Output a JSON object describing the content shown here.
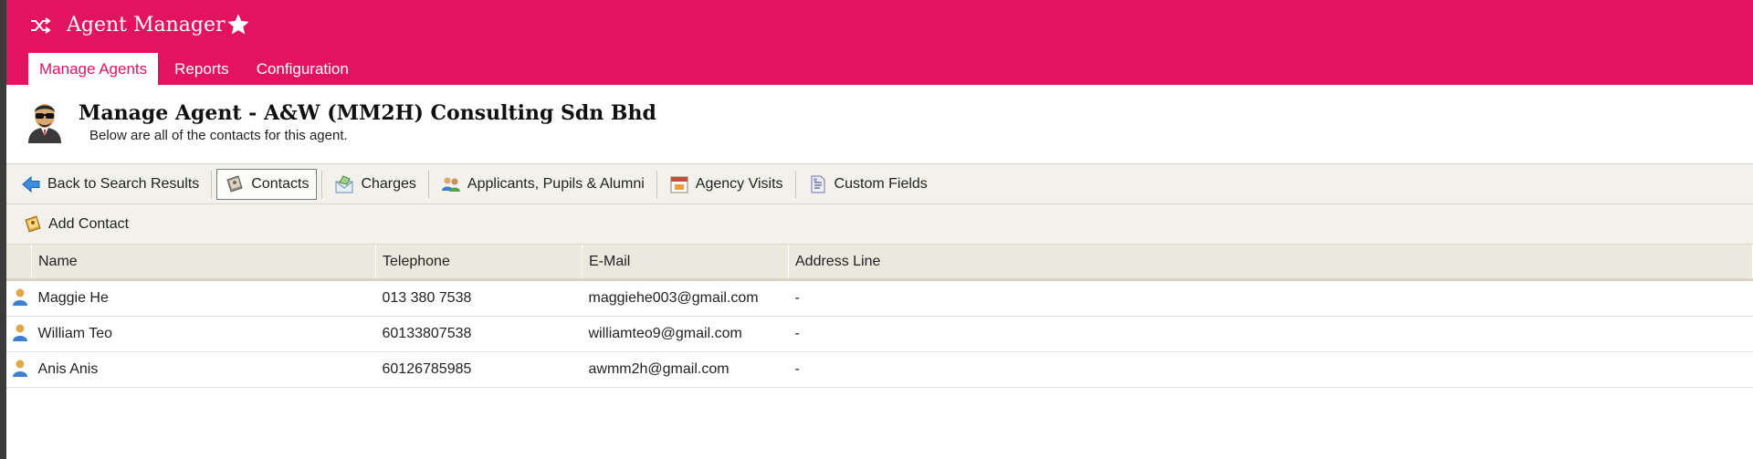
{
  "app": {
    "title": "Agent Manager",
    "brand_color": "#e3135f"
  },
  "nav": {
    "tabs": [
      {
        "label": "Manage Agents",
        "active": true
      },
      {
        "label": "Reports",
        "active": false
      },
      {
        "label": "Configuration",
        "active": false
      }
    ]
  },
  "page": {
    "title": "Manage Agent - A&W (MM2H) Consulting Sdn Bhd",
    "subtitle": "Below are all of the contacts for this agent."
  },
  "toolbar": {
    "back_label": "Back to Search Results",
    "contacts_label": "Contacts",
    "charges_label": "Charges",
    "applicants_label": "Applicants, Pupils & Alumni",
    "visits_label": "Agency Visits",
    "custom_fields_label": "Custom Fields",
    "selected": "Contacts"
  },
  "subbar": {
    "add_contact_label": "Add Contact"
  },
  "table": {
    "columns": [
      "Name",
      "Telephone",
      "E-Mail",
      "Address Line"
    ],
    "rows": [
      {
        "name": "Maggie He",
        "telephone": "013 380 7538",
        "email": "maggiehe003@gmail.com",
        "address": "-"
      },
      {
        "name": "William Teo",
        "telephone": "60133807538",
        "email": "williamteo9@gmail.com",
        "address": "-"
      },
      {
        "name": "Anis Anis",
        "telephone": "60126785985",
        "email": "awmm2h@gmail.com",
        "address": "-"
      }
    ]
  }
}
